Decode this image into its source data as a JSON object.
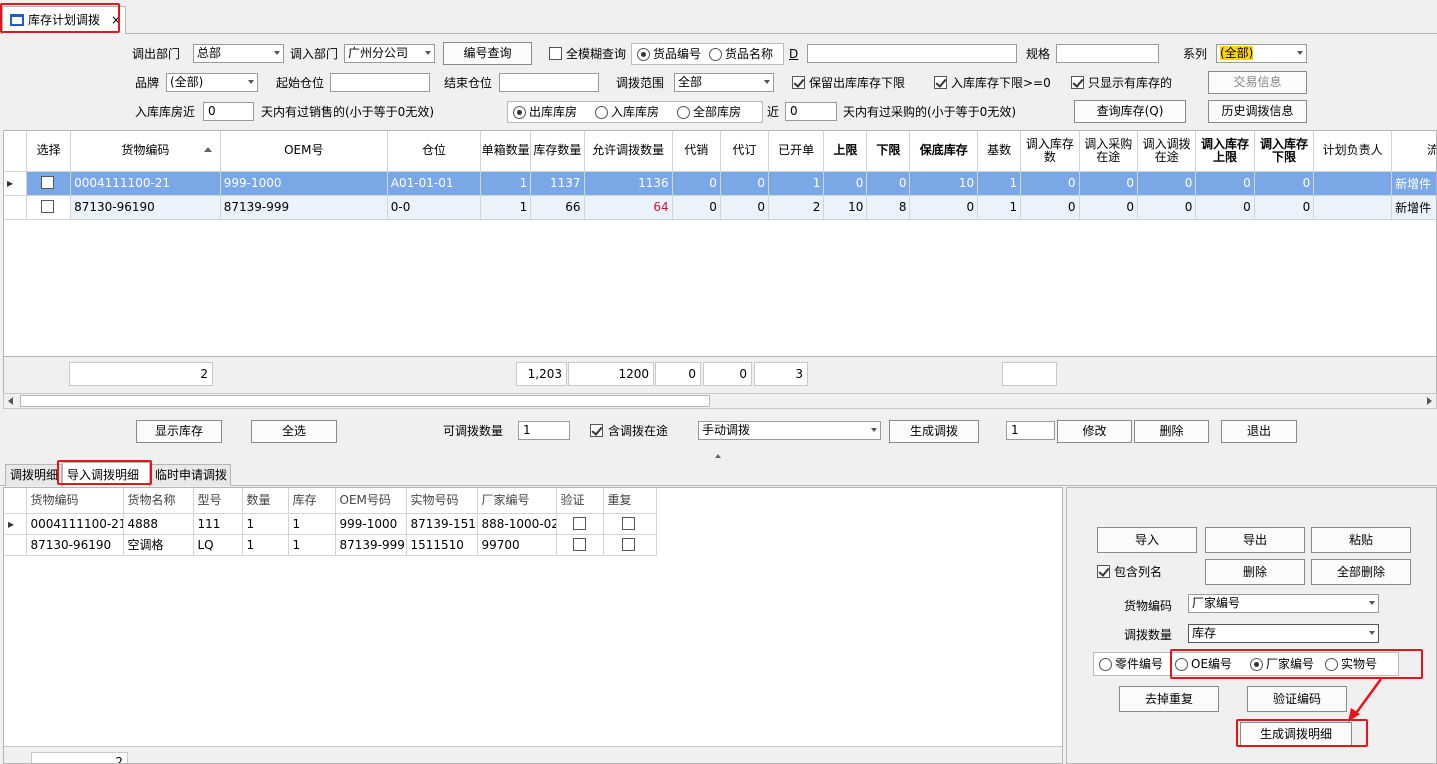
{
  "window_tab": {
    "title": "库存计划调拨",
    "close": "×"
  },
  "filters": {
    "out_dept_label": "调出部门",
    "out_dept_value": "总部",
    "in_dept_label": "调入部门",
    "in_dept_value": "广州分公司",
    "code_query_button": "编号查询",
    "fuzzy_label": "全模糊查询",
    "radio_goods_code": "货品编号",
    "radio_goods_name": "货品名称",
    "d_label": "D",
    "d_value": "",
    "spec_label": "规格",
    "spec_value": "",
    "series_label": "系列",
    "series_value": "(全部)",
    "brand_label": "品牌",
    "brand_value": "(全部)",
    "start_loc_label": "起始仓位",
    "start_loc_value": "",
    "end_loc_label": "结束仓位",
    "end_loc_value": "",
    "range_label": "调拨范围",
    "range_value": "全部",
    "keep_out_lower_label": "保留出库库存下限",
    "in_lower_label": "入库库存下限>=0",
    "only_stock_label": "只显示有库存的",
    "trade_info_button": "交易信息",
    "in_near_label": "入库库房近",
    "in_near_value": "0",
    "days_sold_label": "天内有过销售的(小于等于0无效)",
    "radio_out_store": "出库库房",
    "radio_in_store": "入库库房",
    "radio_all_store": "全部库房",
    "near_label": "近",
    "near_value": "0",
    "days_purchase_label": "天内有过采购的(小于等于0无效)",
    "query_stock_button": "查询库存(Q)",
    "history_button": "历史调拨信息"
  },
  "grid": {
    "columns": [
      "选择",
      "货物编码",
      "OEM号",
      "仓位",
      "单箱数量",
      "库存数量",
      "允许调拨数量",
      "代销",
      "代订",
      "已开单",
      "上限",
      "下限",
      "保底库存",
      "基数",
      "调入库存数",
      "调入采购在途",
      "调入调拨在途",
      "调入库存上限",
      "调入库存下限",
      "计划负责人",
      "流量分"
    ],
    "rows": [
      {
        "code": "0004111100-21",
        "oem": "999-1000",
        "loc": "A01-01-01",
        "box": "1",
        "stock": "1137",
        "allow": "1136",
        "consign": "0",
        "order": "0",
        "opened": "1",
        "upper": "0",
        "lower": "0",
        "safety": "10",
        "base": "1",
        "in_stock": "0",
        "in_purchase": "0",
        "in_transfer": "0",
        "in_upper": "0",
        "in_lower": "0",
        "planner": "",
        "flow": "新增件"
      },
      {
        "code": "87130-96190",
        "oem": "87139-999",
        "loc": "0-0",
        "box": "1",
        "stock": "66",
        "allow": "64",
        "consign": "0",
        "order": "0",
        "opened": "2",
        "upper": "10",
        "lower": "8",
        "safety": "0",
        "base": "1",
        "in_stock": "0",
        "in_purchase": "0",
        "in_transfer": "0",
        "in_upper": "0",
        "in_lower": "0",
        "planner": "",
        "flow": "新增件"
      }
    ],
    "summary": {
      "count": "2",
      "stock": "1,203",
      "allow": "1200",
      "consign": "0",
      "order": "0",
      "opened": "3",
      "in_stock": ""
    }
  },
  "actions": {
    "show_stock_button": "显示库存",
    "select_all_button": "全选",
    "qty_label": "可调拨数量",
    "qty_value": "1",
    "include_transit_label": "含调拨在途",
    "mode_value": "手动调拨",
    "generate_button": "生成调拨",
    "modify_qty_value": "1",
    "modify_button": "修改",
    "delete_button": "删除",
    "exit_button": "退出"
  },
  "lower_tabs": [
    "调拨明细",
    "导入调拨明细",
    "临时申请调拨"
  ],
  "import_grid": {
    "columns": [
      "货物编码",
      "货物名称",
      "型号",
      "数量",
      "库存",
      "OEM号码",
      "实物号码",
      "厂家编号",
      "验证",
      "重复"
    ],
    "rows": [
      {
        "code": "0004111100-21",
        "name": "4888",
        "model": "111",
        "qty": "1",
        "stock": "1",
        "oem": "999-1000",
        "phys": "87139-151",
        "factory": "888-1000-02"
      },
      {
        "code": "87130-96190",
        "name": "空调格",
        "model": "LQ",
        "qty": "1",
        "stock": "1",
        "oem": "87139-999",
        "phys": "1511510",
        "factory": "99700"
      }
    ],
    "footer_count": "2"
  },
  "right_panel": {
    "import_button": "导入",
    "export_button": "导出",
    "paste_button": "粘贴",
    "include_col_label": "包含列名",
    "delete_button": "删除",
    "delete_all_button": "全部删除",
    "goods_code_label": "货物编码",
    "goods_code_value": "厂家编号",
    "qty_label": "调拨数量",
    "qty_value": "库存",
    "radio_part": "零件编号",
    "radio_oe": "OE编号",
    "radio_factory": "厂家编号",
    "radio_phys": "实物号",
    "dedupe_button": "去掉重复",
    "verify_button": "验证编码",
    "generate_detail_button": "生成调拨明细"
  },
  "colors": {
    "selected_row": "#7aa7e6",
    "highlight": "#ffd700",
    "annotation": "#e8141b",
    "allow_qty": "#d0142c"
  }
}
